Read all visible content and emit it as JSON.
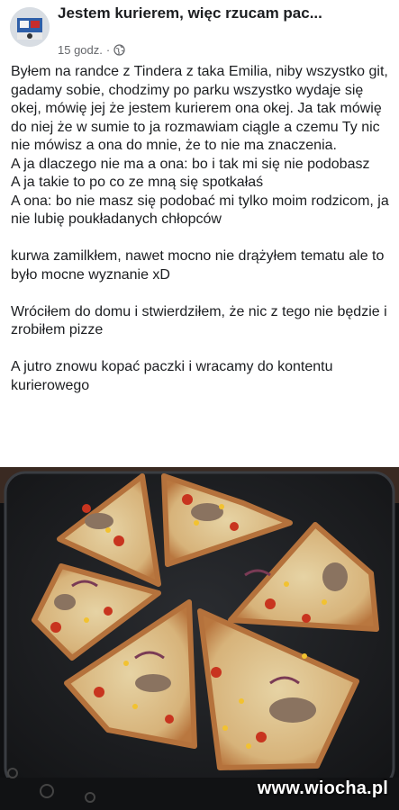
{
  "post": {
    "title": "Jestem kurierem, więc rzucam pac...",
    "time": "15 godz.",
    "separator": "·",
    "privacy_icon": "globe-icon",
    "paragraphs": [
      "Byłem na randce z Tindera z taka Emilia, niby wszystko git, gadamy sobie, chodzimy po parku wszystko wydaje się okej, mówię jej że jestem kurierem ona okej. Ja tak mówię do niej że w sumie to ja rozmawiam ciągle a czemu Ty nic nie mówisz a ona do mnie, że to nie ma znaczenia.\nA ja dlaczego nie ma a ona: bo i tak mi się nie podobasz\nA ja takie to po co ze mną się spotkałaś\nA ona: bo nie masz się podobać mi tylko moim rodzicom, ja nie lubię poukładanych chłopców",
      "kurwa zamilkłem, nawet mocno nie drążyłem tematu ale to było mocne wyznanie xD",
      "Wróciłem do domu i stwierdziłem, że nic z tego nie będzie i zrobiłem pizze",
      "A jutro znowu kopać paczki i wracamy do kontentu kurierowego"
    ]
  },
  "watermark": "www.wiocha.pl",
  "colors": {
    "text": "#1c1e21",
    "meta": "#65676b",
    "tray": "#1e1f22",
    "crust": "#c98a4f",
    "cheese": "#e9d9a8",
    "pepper_red": "#c8341f",
    "corn": "#f2c230",
    "mushroom": "#8a7360",
    "onion": "#7a3b55"
  }
}
